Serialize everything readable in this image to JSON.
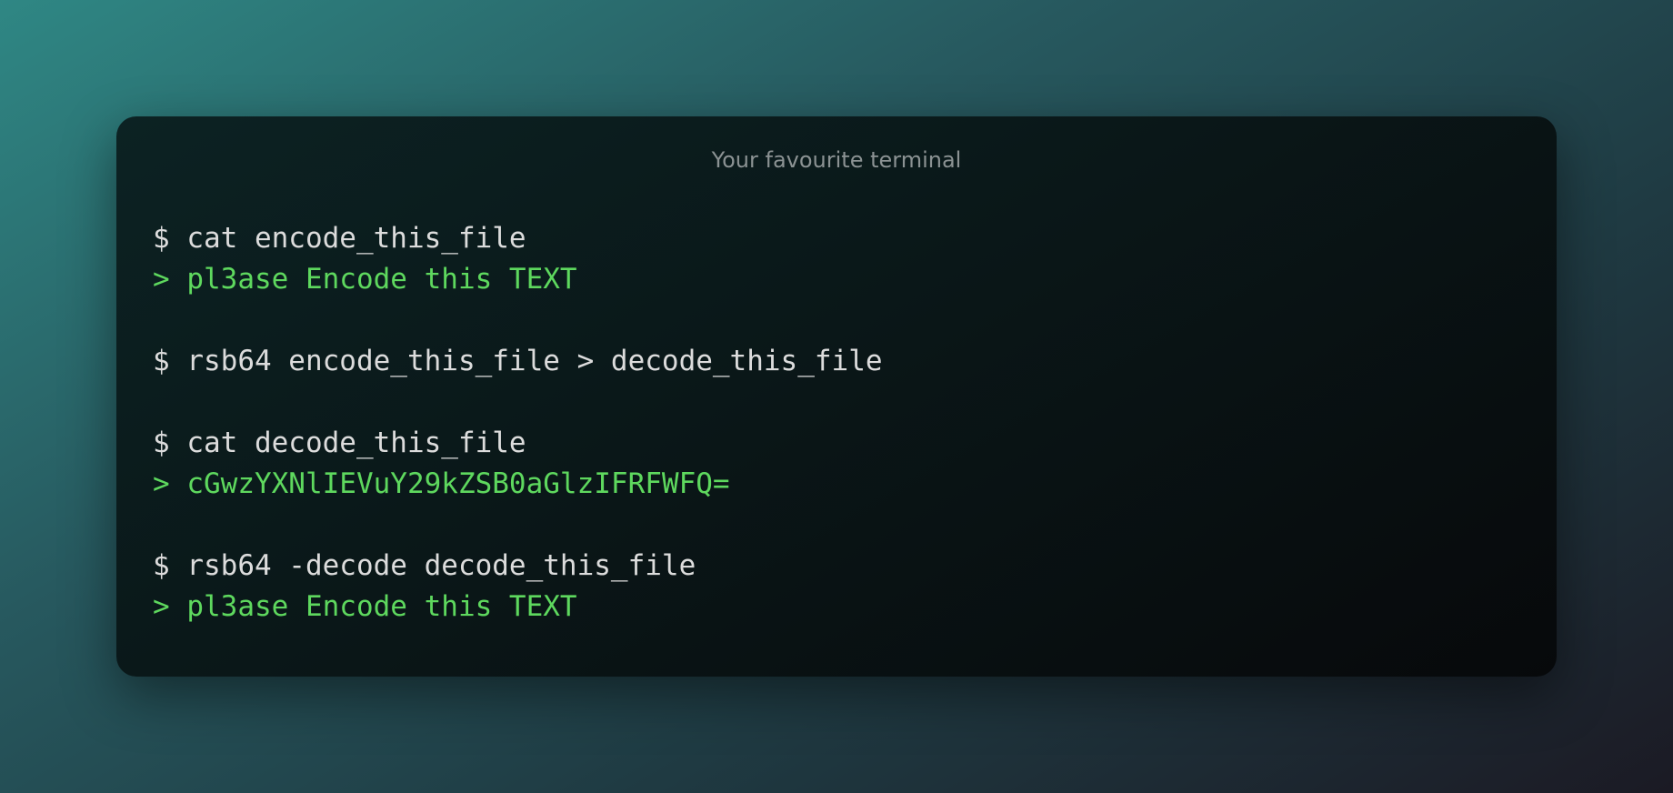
{
  "terminal": {
    "title": "Your favourite terminal",
    "lines": [
      {
        "kind": "prompt",
        "text": "$ cat encode_this_file"
      },
      {
        "kind": "output",
        "text": "> pl3ase Encode this TEXT"
      },
      {
        "kind": "blank",
        "text": ""
      },
      {
        "kind": "prompt",
        "text": "$ rsb64 encode_this_file > decode_this_file"
      },
      {
        "kind": "blank",
        "text": ""
      },
      {
        "kind": "prompt",
        "text": "$ cat decode_this_file"
      },
      {
        "kind": "output",
        "text": "> cGwzYXNlIEVuY29kZSB0aGlzIFRFWFQ="
      },
      {
        "kind": "blank",
        "text": ""
      },
      {
        "kind": "prompt",
        "text": "$ rsb64 -decode decode_this_file"
      },
      {
        "kind": "output",
        "text": "> pl3ase Encode this TEXT"
      }
    ]
  },
  "colors": {
    "prompt_text": "#dcdcdc",
    "output_text": "#5ed85e",
    "title_text": "#8b9293"
  }
}
